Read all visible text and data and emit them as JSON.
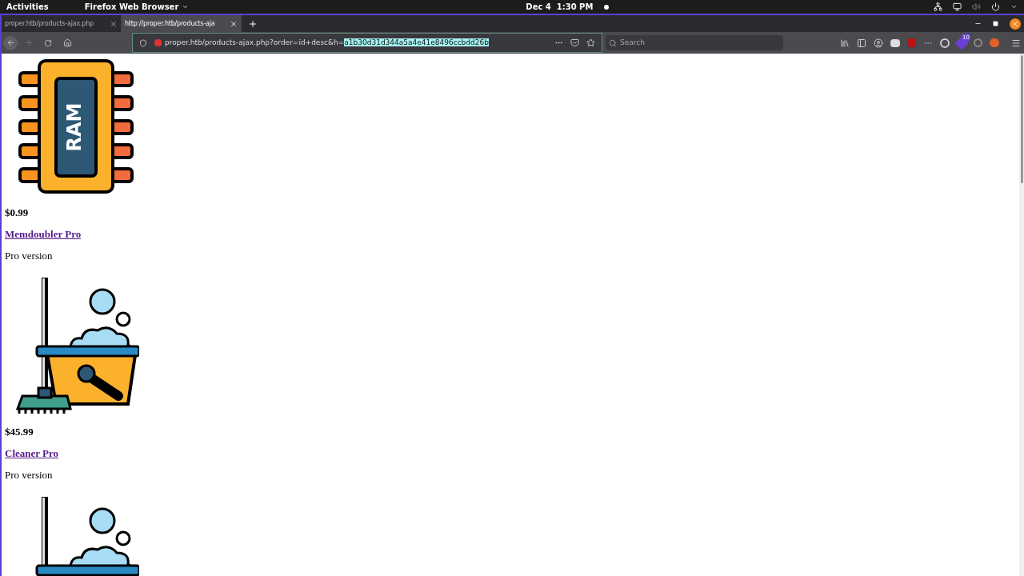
{
  "top_bar": {
    "activities": "Activities",
    "app_menu": "Firefox Web Browser",
    "clock": "Dec 4  1:30 PM"
  },
  "tabs": [
    {
      "title": "proper.htb/products-ajax.php",
      "selected": false
    },
    {
      "title": "http://proper.htb/products-aja",
      "selected": true
    }
  ],
  "address_bar": {
    "url": "proper.htb/products-ajax.php?order=id+desc&h=",
    "selected_text": "a1b30d31d344a5a4e41e8496ccbdd26b"
  },
  "search": {
    "placeholder": "Search"
  },
  "extension_badge": "10",
  "products": [
    {
      "kind": "ram",
      "image_label": "RAM",
      "price": "$0.99",
      "name": "Memdoubler Pro",
      "description": "Pro version"
    },
    {
      "kind": "cleaner",
      "price": "$45.99",
      "name": "Cleaner Pro",
      "description": "Pro version"
    },
    {
      "kind": "cleaner"
    }
  ]
}
